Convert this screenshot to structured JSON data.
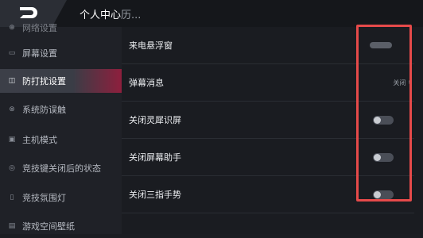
{
  "header": {
    "title": "个人中心",
    "subtitle": "历..."
  },
  "sidebar": {
    "items": [
      {
        "label": "网络设置",
        "icon": "network-icon"
      },
      {
        "label": "屏幕设置",
        "icon": "screen-icon"
      },
      {
        "label": "防打扰设置",
        "icon": "do-not-disturb-icon",
        "active": true
      },
      {
        "label": "系统防误触",
        "icon": "touch-guard-icon"
      },
      {
        "label": "主机模式",
        "icon": "console-icon"
      },
      {
        "label": "竞技键关闭后的状态",
        "icon": "game-key-icon"
      },
      {
        "label": "竞技氛围灯",
        "icon": "ambient-light-icon"
      },
      {
        "label": "游戏空间壁纸",
        "icon": "wallpaper-icon"
      }
    ]
  },
  "settings": {
    "rows": [
      {
        "label": "来电悬浮窗",
        "control": "toggle",
        "state": "off"
      },
      {
        "label": "弹幕消息",
        "control": "link",
        "value": "关闭"
      },
      {
        "label": "关闭灵犀识屏",
        "control": "toggle",
        "state": "off"
      },
      {
        "label": "关闭屏幕助手",
        "control": "toggle",
        "state": "off"
      },
      {
        "label": "关闭三指手势",
        "control": "toggle",
        "state": "off"
      }
    ]
  },
  "colors": {
    "accent": "#8e1f3d",
    "highlight_box": "#e64a4a"
  }
}
